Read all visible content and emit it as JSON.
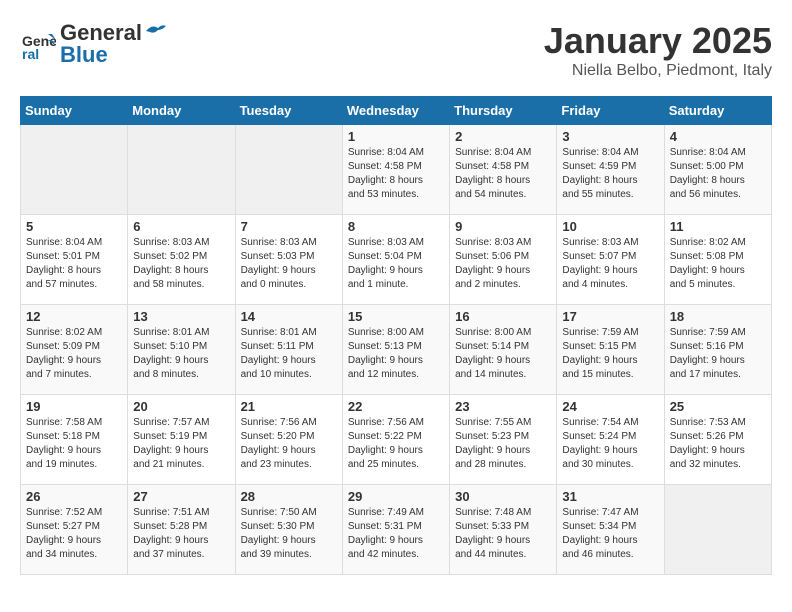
{
  "header": {
    "logo_line1": "General",
    "logo_line2": "Blue",
    "month": "January 2025",
    "location": "Niella Belbo, Piedmont, Italy"
  },
  "weekdays": [
    "Sunday",
    "Monday",
    "Tuesday",
    "Wednesday",
    "Thursday",
    "Friday",
    "Saturday"
  ],
  "weeks": [
    [
      {
        "day": "",
        "info": ""
      },
      {
        "day": "",
        "info": ""
      },
      {
        "day": "",
        "info": ""
      },
      {
        "day": "1",
        "info": "Sunrise: 8:04 AM\nSunset: 4:58 PM\nDaylight: 8 hours\nand 53 minutes."
      },
      {
        "day": "2",
        "info": "Sunrise: 8:04 AM\nSunset: 4:58 PM\nDaylight: 8 hours\nand 54 minutes."
      },
      {
        "day": "3",
        "info": "Sunrise: 8:04 AM\nSunset: 4:59 PM\nDaylight: 8 hours\nand 55 minutes."
      },
      {
        "day": "4",
        "info": "Sunrise: 8:04 AM\nSunset: 5:00 PM\nDaylight: 8 hours\nand 56 minutes."
      }
    ],
    [
      {
        "day": "5",
        "info": "Sunrise: 8:04 AM\nSunset: 5:01 PM\nDaylight: 8 hours\nand 57 minutes."
      },
      {
        "day": "6",
        "info": "Sunrise: 8:03 AM\nSunset: 5:02 PM\nDaylight: 8 hours\nand 58 minutes."
      },
      {
        "day": "7",
        "info": "Sunrise: 8:03 AM\nSunset: 5:03 PM\nDaylight: 9 hours\nand 0 minutes."
      },
      {
        "day": "8",
        "info": "Sunrise: 8:03 AM\nSunset: 5:04 PM\nDaylight: 9 hours\nand 1 minute."
      },
      {
        "day": "9",
        "info": "Sunrise: 8:03 AM\nSunset: 5:06 PM\nDaylight: 9 hours\nand 2 minutes."
      },
      {
        "day": "10",
        "info": "Sunrise: 8:03 AM\nSunset: 5:07 PM\nDaylight: 9 hours\nand 4 minutes."
      },
      {
        "day": "11",
        "info": "Sunrise: 8:02 AM\nSunset: 5:08 PM\nDaylight: 9 hours\nand 5 minutes."
      }
    ],
    [
      {
        "day": "12",
        "info": "Sunrise: 8:02 AM\nSunset: 5:09 PM\nDaylight: 9 hours\nand 7 minutes."
      },
      {
        "day": "13",
        "info": "Sunrise: 8:01 AM\nSunset: 5:10 PM\nDaylight: 9 hours\nand 8 minutes."
      },
      {
        "day": "14",
        "info": "Sunrise: 8:01 AM\nSunset: 5:11 PM\nDaylight: 9 hours\nand 10 minutes."
      },
      {
        "day": "15",
        "info": "Sunrise: 8:00 AM\nSunset: 5:13 PM\nDaylight: 9 hours\nand 12 minutes."
      },
      {
        "day": "16",
        "info": "Sunrise: 8:00 AM\nSunset: 5:14 PM\nDaylight: 9 hours\nand 14 minutes."
      },
      {
        "day": "17",
        "info": "Sunrise: 7:59 AM\nSunset: 5:15 PM\nDaylight: 9 hours\nand 15 minutes."
      },
      {
        "day": "18",
        "info": "Sunrise: 7:59 AM\nSunset: 5:16 PM\nDaylight: 9 hours\nand 17 minutes."
      }
    ],
    [
      {
        "day": "19",
        "info": "Sunrise: 7:58 AM\nSunset: 5:18 PM\nDaylight: 9 hours\nand 19 minutes."
      },
      {
        "day": "20",
        "info": "Sunrise: 7:57 AM\nSunset: 5:19 PM\nDaylight: 9 hours\nand 21 minutes."
      },
      {
        "day": "21",
        "info": "Sunrise: 7:56 AM\nSunset: 5:20 PM\nDaylight: 9 hours\nand 23 minutes."
      },
      {
        "day": "22",
        "info": "Sunrise: 7:56 AM\nSunset: 5:22 PM\nDaylight: 9 hours\nand 25 minutes."
      },
      {
        "day": "23",
        "info": "Sunrise: 7:55 AM\nSunset: 5:23 PM\nDaylight: 9 hours\nand 28 minutes."
      },
      {
        "day": "24",
        "info": "Sunrise: 7:54 AM\nSunset: 5:24 PM\nDaylight: 9 hours\nand 30 minutes."
      },
      {
        "day": "25",
        "info": "Sunrise: 7:53 AM\nSunset: 5:26 PM\nDaylight: 9 hours\nand 32 minutes."
      }
    ],
    [
      {
        "day": "26",
        "info": "Sunrise: 7:52 AM\nSunset: 5:27 PM\nDaylight: 9 hours\nand 34 minutes."
      },
      {
        "day": "27",
        "info": "Sunrise: 7:51 AM\nSunset: 5:28 PM\nDaylight: 9 hours\nand 37 minutes."
      },
      {
        "day": "28",
        "info": "Sunrise: 7:50 AM\nSunset: 5:30 PM\nDaylight: 9 hours\nand 39 minutes."
      },
      {
        "day": "29",
        "info": "Sunrise: 7:49 AM\nSunset: 5:31 PM\nDaylight: 9 hours\nand 42 minutes."
      },
      {
        "day": "30",
        "info": "Sunrise: 7:48 AM\nSunset: 5:33 PM\nDaylight: 9 hours\nand 44 minutes."
      },
      {
        "day": "31",
        "info": "Sunrise: 7:47 AM\nSunset: 5:34 PM\nDaylight: 9 hours\nand 46 minutes."
      },
      {
        "day": "",
        "info": ""
      }
    ]
  ]
}
